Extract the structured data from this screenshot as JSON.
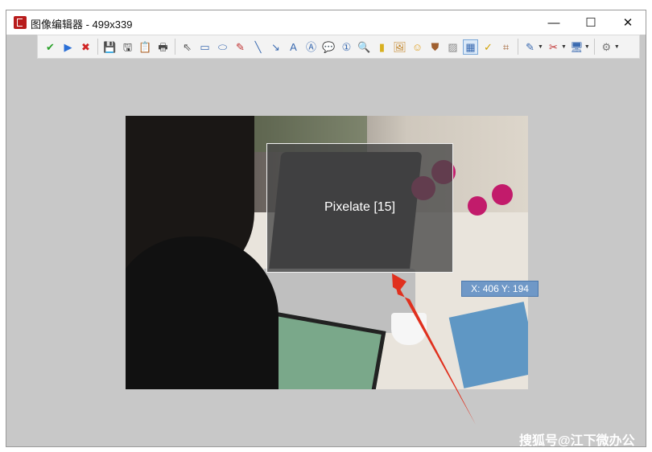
{
  "window": {
    "title": "图像编辑器 - 499x339",
    "controls": {
      "minimize": "—",
      "maximize": "☐",
      "close": "✕"
    }
  },
  "toolbar": {
    "buttons": [
      {
        "name": "apply-button",
        "glyph": "✔",
        "color": "#2aa12a"
      },
      {
        "name": "play-button",
        "glyph": "▶",
        "color": "#2a6fd6"
      },
      {
        "name": "cancel-button",
        "glyph": "✖",
        "color": "#d02525"
      },
      {
        "name": "sep"
      },
      {
        "name": "save-button",
        "glyph": "💾",
        "color": "#333"
      },
      {
        "name": "save-as-button",
        "glyph": "🖫",
        "color": "#333"
      },
      {
        "name": "clipboard-button",
        "glyph": "📋",
        "color": "#b07a2a"
      },
      {
        "name": "print-button",
        "glyph": "🖶",
        "color": "#444"
      },
      {
        "name": "sep"
      },
      {
        "name": "pointer-tool",
        "glyph": "⇖",
        "color": "#555"
      },
      {
        "name": "rectangle-tool",
        "glyph": "▭",
        "color": "#3a6ab0"
      },
      {
        "name": "ellipse-tool",
        "glyph": "⬭",
        "color": "#3a6ab0"
      },
      {
        "name": "pencil-tool",
        "glyph": "✎",
        "color": "#c03030"
      },
      {
        "name": "line-tool",
        "glyph": "╲",
        "color": "#3a6ab0"
      },
      {
        "name": "arrow-tool",
        "glyph": "↘",
        "color": "#3a6ab0"
      },
      {
        "name": "text-tool",
        "glyph": "A",
        "color": "#3a6ab0"
      },
      {
        "name": "textbox-tool",
        "glyph": "Ⓐ",
        "color": "#3a6ab0"
      },
      {
        "name": "speech-bubble-tool",
        "glyph": "💬",
        "color": "#3a6ab0"
      },
      {
        "name": "counter-tool",
        "glyph": "①",
        "color": "#3a6ab0"
      },
      {
        "name": "magnifier-tool",
        "glyph": "🔍",
        "color": "#3a6ab0"
      },
      {
        "name": "highlight-tool",
        "glyph": "▮",
        "color": "#d8b020"
      },
      {
        "name": "image-tool",
        "glyph": "🖼",
        "color": "#c08020"
      },
      {
        "name": "emoji-tool",
        "glyph": "☺",
        "color": "#e0a020"
      },
      {
        "name": "stamp-tool",
        "glyph": "⛊",
        "color": "#a06030"
      },
      {
        "name": "blur-tool",
        "glyph": "▨",
        "color": "#888"
      },
      {
        "name": "pixelate-tool",
        "glyph": "▦",
        "color": "#3a6ab0",
        "selected": true
      },
      {
        "name": "spellcheck-tool",
        "glyph": "✓",
        "color": "#d0a000"
      },
      {
        "name": "crop-tool",
        "glyph": "⌗",
        "color": "#a06030"
      },
      {
        "name": "sep"
      },
      {
        "name": "edit-menu-button",
        "glyph": "✎",
        "color": "#3a6ab0",
        "dropdown": true
      },
      {
        "name": "tools-menu-button",
        "glyph": "✂",
        "color": "#c03030",
        "dropdown": true
      },
      {
        "name": "screen-menu-button",
        "glyph": "🖥",
        "color": "#3a6ab0",
        "dropdown": true
      },
      {
        "name": "sep"
      },
      {
        "name": "settings-button",
        "glyph": "⚙",
        "color": "#777",
        "dropdown": true
      }
    ]
  },
  "canvas": {
    "overlay_label": "Pixelate [15]",
    "coordinates": "X: 406 Y: 194"
  },
  "watermark": "搜狐号@江下微办公",
  "colors": {
    "annotation_arrow": "#e0301e",
    "coord_bg": "#6f98c7"
  }
}
